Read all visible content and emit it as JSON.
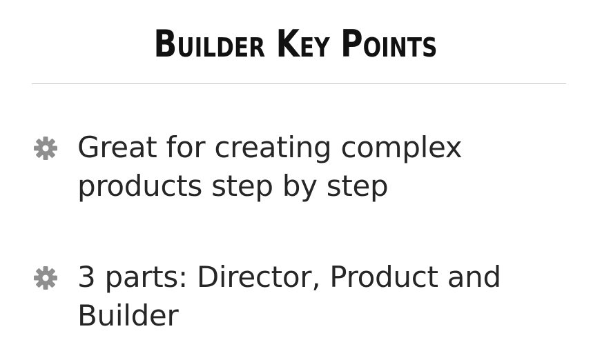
{
  "slide": {
    "title": "Builder Key Points",
    "bullets": [
      {
        "icon": "gear-icon",
        "lines": [
          "Great for creating complex",
          "products step by step"
        ]
      },
      {
        "icon": "gear-icon",
        "lines": [
          "3 parts: Director, Product and",
          "Builder"
        ]
      }
    ],
    "colors": {
      "title": "#111111",
      "text": "#262626",
      "icon": "#8f8f8f",
      "divider": "#c4c4c4",
      "background": "#ffffff"
    }
  }
}
